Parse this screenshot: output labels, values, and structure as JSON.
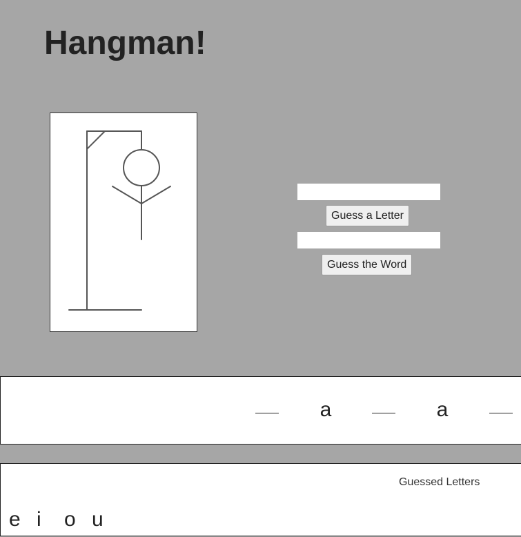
{
  "title": "Hangman!",
  "controls": {
    "letter_input_value": "",
    "letter_button_label": "Guess a Letter",
    "word_input_value": "",
    "word_button_label": "Guess the Word"
  },
  "hangman": {
    "wrong_guesses_shown": [
      "head",
      "body",
      "left-arm",
      "right-arm"
    ]
  },
  "word": {
    "slots": [
      "",
      "a",
      "",
      "a",
      ""
    ]
  },
  "guessed": {
    "title": "Guessed Letters",
    "letters": [
      "e",
      "i",
      "o",
      "u"
    ]
  }
}
